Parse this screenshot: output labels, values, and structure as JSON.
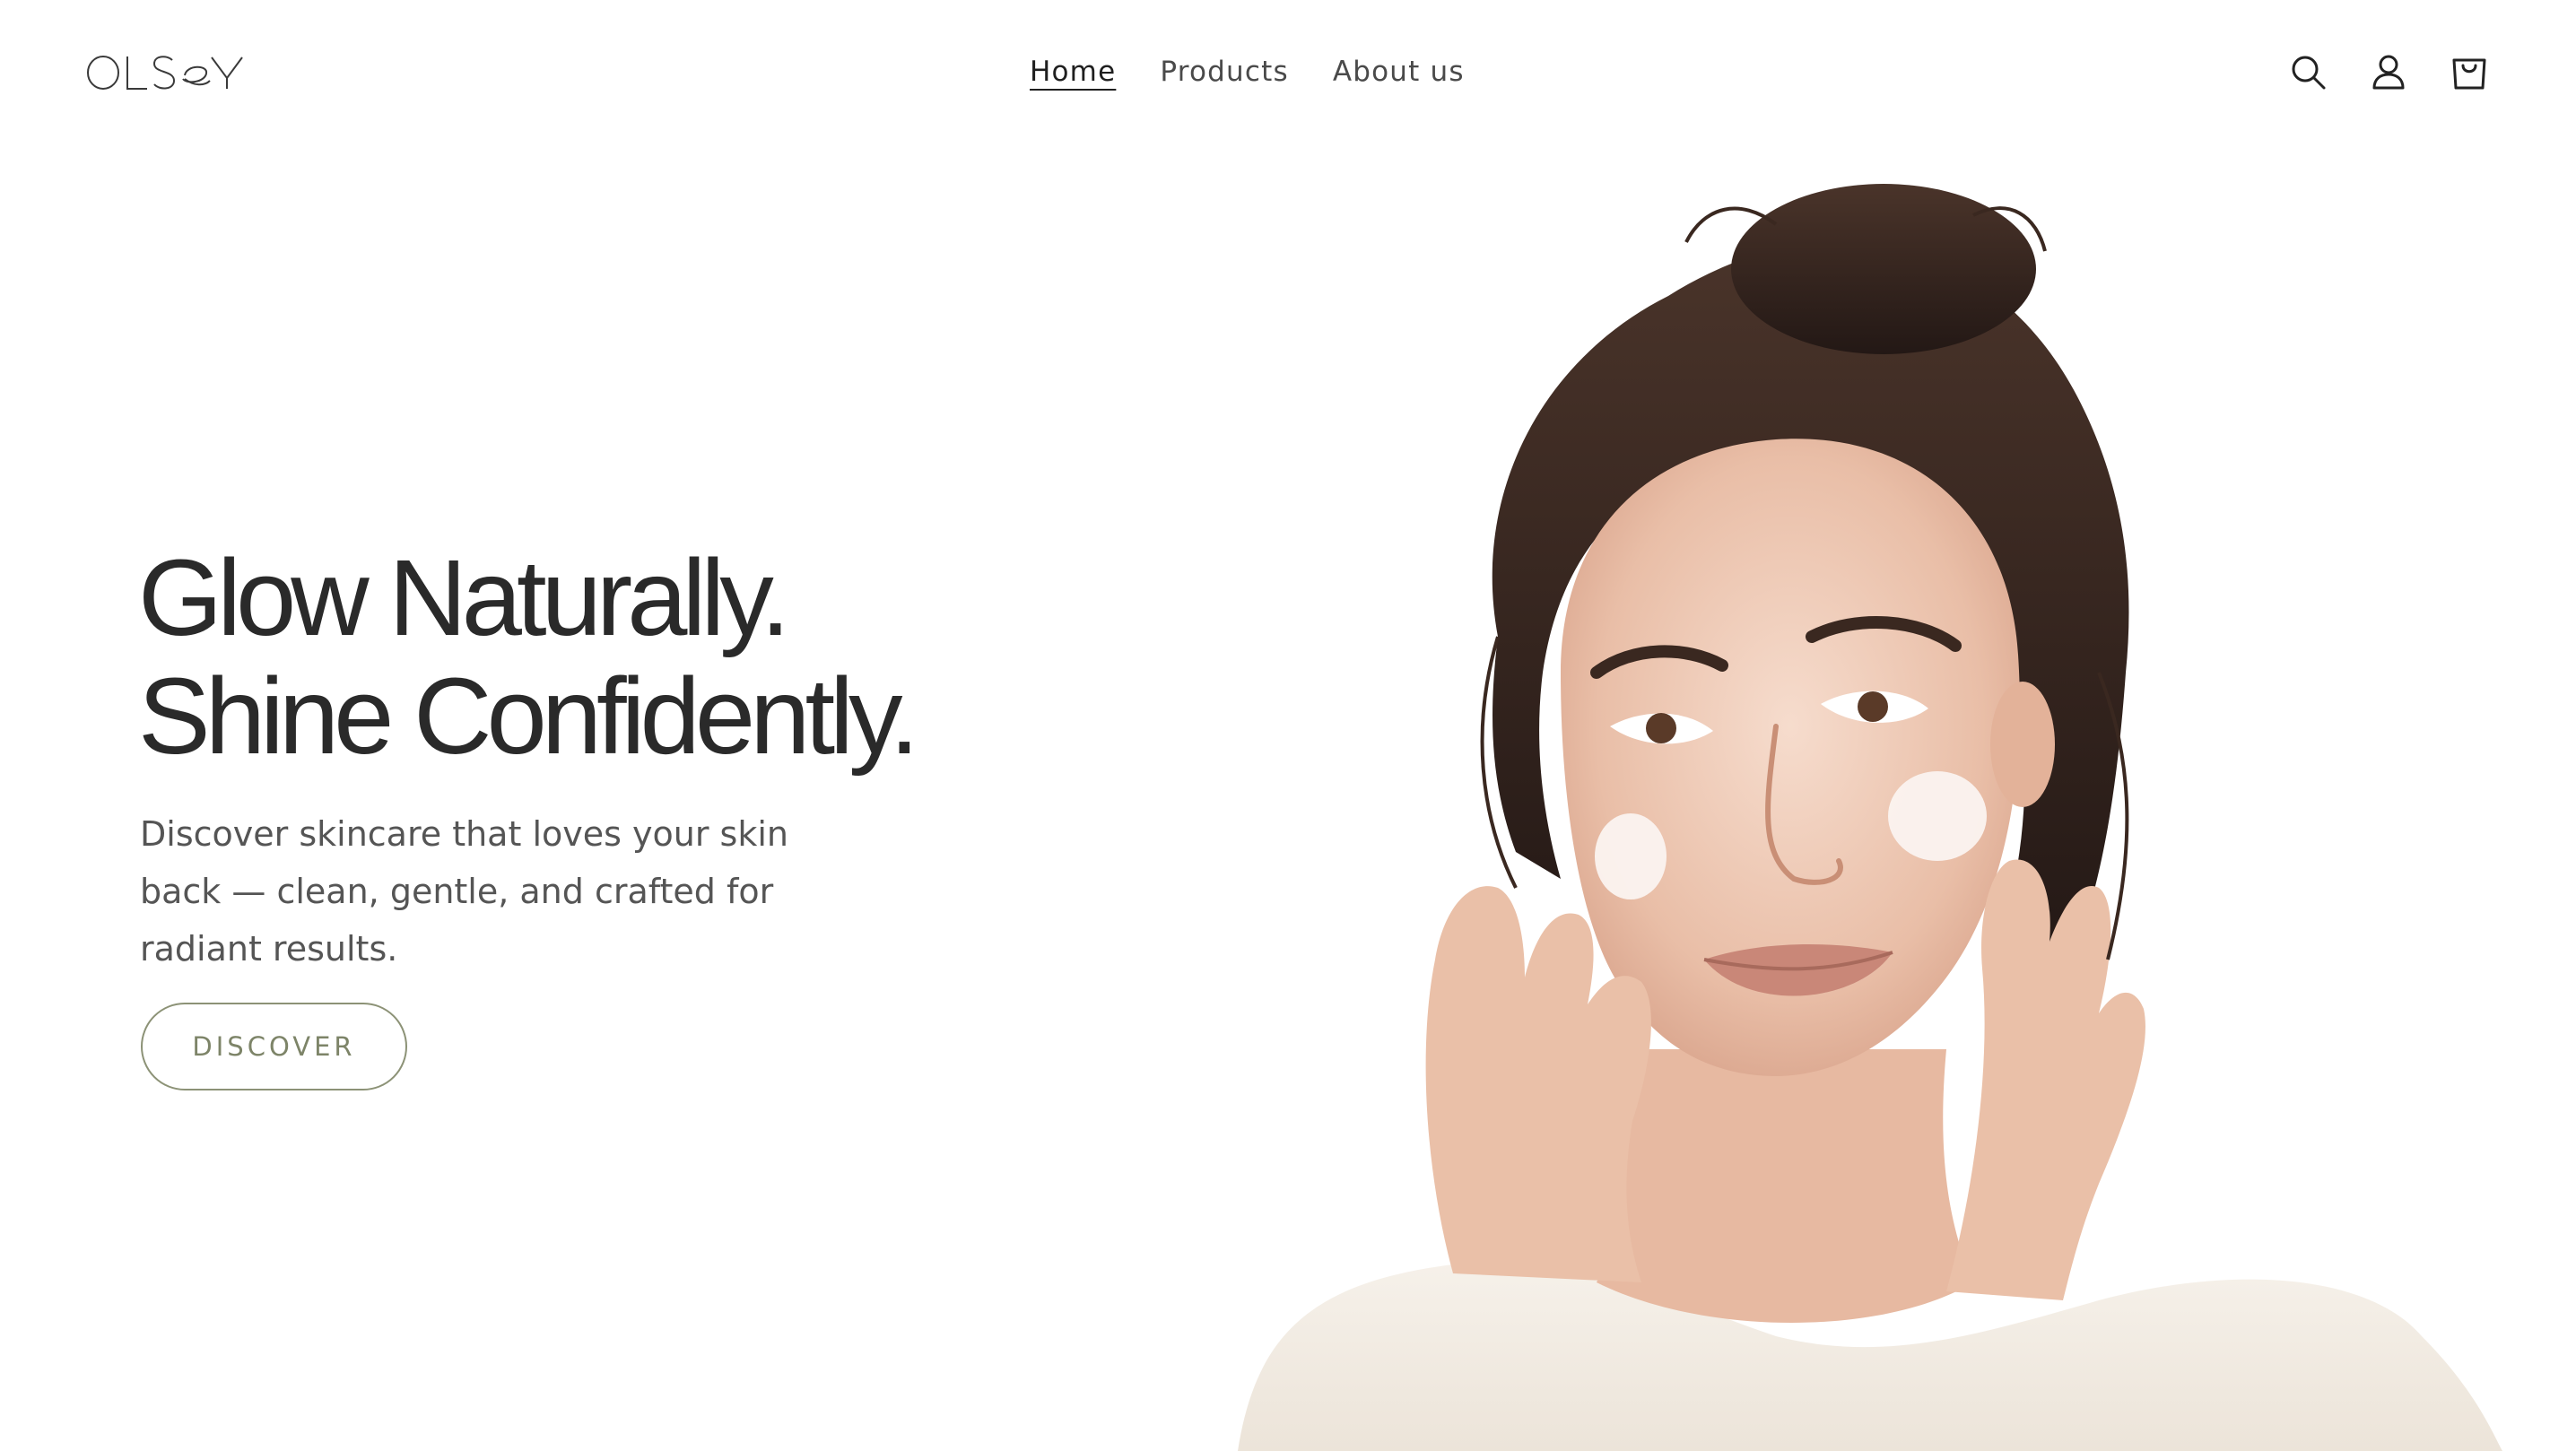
{
  "brand": {
    "logo_text": "OLSEY"
  },
  "nav": {
    "items": [
      {
        "label": "Home",
        "active": true
      },
      {
        "label": "Products",
        "active": false
      },
      {
        "label": "About us",
        "active": false
      }
    ]
  },
  "header_icons": [
    "search-icon",
    "account-icon",
    "cart-icon"
  ],
  "hero": {
    "title_line1": "Glow Naturally.",
    "title_line2": "Shine Confidently.",
    "subtitle": "Discover skincare that loves your skin back — clean, gentle, and crafted for radiant results.",
    "cta_label": "DISCOVER"
  },
  "colors": {
    "text_dark": "#2a2a2a",
    "cta_accent": "#7d8468",
    "background": "#ffffff"
  }
}
